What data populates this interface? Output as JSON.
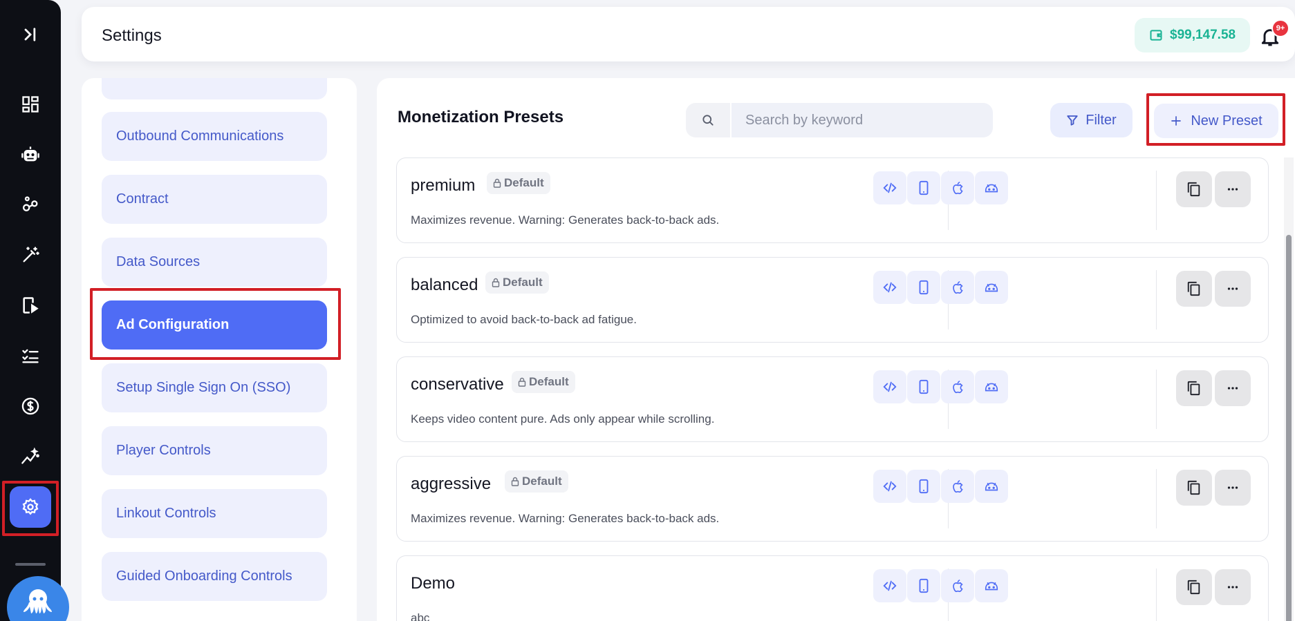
{
  "rail": {
    "items": [
      {
        "icon": "expand-sidebar-icon"
      },
      {
        "icon": "dashboard-icon"
      },
      {
        "icon": "robot-icon"
      },
      {
        "icon": "network-icon"
      },
      {
        "icon": "magic-wand-icon"
      },
      {
        "icon": "mobile-play-icon"
      },
      {
        "icon": "checklist-icon"
      },
      {
        "icon": "dollar-icon"
      },
      {
        "icon": "analytics-icon"
      },
      {
        "icon": "gear-icon",
        "active": true
      }
    ],
    "avatar_icon": "octopus-icon"
  },
  "header": {
    "title": "Settings",
    "balance": "$99,147.58",
    "notification_badge": "9+"
  },
  "settings_nav": {
    "items": [
      {
        "label": ""
      },
      {
        "label": "Outbound Communications"
      },
      {
        "label": "Contract"
      },
      {
        "label": "Data Sources"
      },
      {
        "label": "Ad Configuration",
        "active": true
      },
      {
        "label": "Setup Single Sign On (SSO)"
      },
      {
        "label": "Player Controls"
      },
      {
        "label": "Linkout Controls"
      },
      {
        "label": "Guided Onboarding Controls"
      }
    ]
  },
  "main": {
    "title": "Monetization Presets",
    "search_placeholder": "Search by keyword",
    "filter_label": "Filter",
    "new_preset_label": "New Preset",
    "presets": [
      {
        "name": "premium",
        "tag": "Default",
        "description": "Maximizes revenue. Warning: Generates back-to-back ads."
      },
      {
        "name": "balanced",
        "tag": "Default",
        "description": "Optimized to avoid back-to-back ad fatigue."
      },
      {
        "name": "conservative",
        "tag": "Default",
        "description": "Keeps video content pure. Ads only appear while scrolling."
      },
      {
        "name": "aggressive",
        "tag": "Default",
        "description": "Maximizes revenue. Warning: Generates back-to-back ads."
      },
      {
        "name": "Demo",
        "tag": "",
        "description": "abc"
      }
    ],
    "platform_icons": [
      "code-icon",
      "mobile-icon",
      "apple-icon",
      "android-icon"
    ],
    "action_icons": [
      "copy-icon",
      "more-icon"
    ]
  },
  "colors": {
    "accent": "#4f6cf5",
    "rail_bg": "#0d0f15",
    "balance_text": "#1ab394",
    "highlight_frame": "#d21f26",
    "badge": "#e8343f"
  }
}
